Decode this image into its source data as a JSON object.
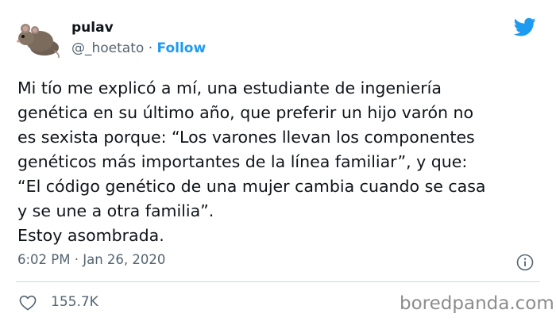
{
  "user": {
    "name": "pulav",
    "handle": "@_hoetato",
    "separator": " · ",
    "follow_label": "Follow"
  },
  "tweet": {
    "text": "Mi tío me explicó a mí, una estudiante de ingeniería\ngenética en su último año, que preferir un hijo varón no\nes sexista porque: “Los varones llevan los componentes\ngenéticos más importantes de la línea familiar”, y que:\n“El código genético de una mujer cambia cuando se casa\ny se une a otra familia”.\nEstoy asombrada.",
    "timestamp": "6:02 PM · Jan 26, 2020",
    "likes": "155.7K"
  },
  "watermark": "boredpanda.com",
  "colors": {
    "accent": "#1d9bf0",
    "secondary_text": "#536471",
    "divider": "#cfd9de"
  },
  "icons": {
    "brand": "twitter-bird-icon",
    "info": "info-icon",
    "like": "heart-icon",
    "avatar": "mouse-avatar"
  }
}
